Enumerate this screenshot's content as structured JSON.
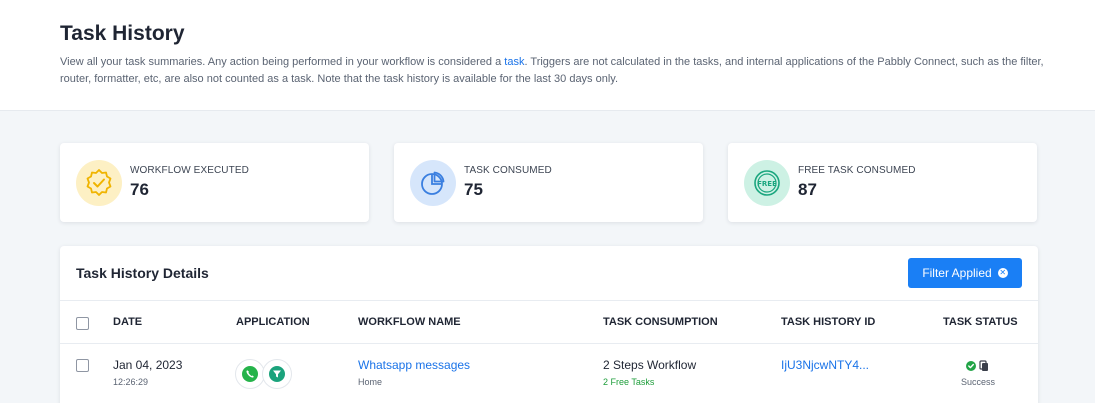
{
  "header": {
    "title": "Task History",
    "desc_part1": "View all your task summaries. Any action being performed in your workflow is considered a ",
    "desc_link": "task",
    "desc_part2": ". Triggers are not calculated in the tasks, and internal applications of the Pabbly Connect, such as the filter, router, formatter, etc, are also not counted as a task. Note that the task history is available for the last 30 days only."
  },
  "stats": [
    {
      "label": "WORKFLOW EXECUTED",
      "value": "76",
      "icon": "verified-badge-icon",
      "color": "#f5b700"
    },
    {
      "label": "TASK CONSUMED",
      "value": "75",
      "icon": "pie-chart-icon",
      "color": "#4a8be8"
    },
    {
      "label": "FREE TASK CONSUMED",
      "value": "87",
      "icon": "free-badge-icon",
      "color": "#1fb38a"
    }
  ],
  "details": {
    "title": "Task History Details",
    "filter_label": "Filter Applied",
    "columns": [
      "DATE",
      "APPLICATION",
      "WORKFLOW NAME",
      "TASK CONSUMPTION",
      "TASK HISTORY ID",
      "TASK STATUS"
    ],
    "rows": [
      {
        "date": "Jan 04, 2023",
        "time": "12:26:29",
        "apps": [
          "whatsapp-icon",
          "filter-icon"
        ],
        "workflow_name": "Whatsapp messages",
        "workflow_folder": "Home",
        "consumption": "2 Steps Workflow",
        "free_tasks": "2 Free Tasks",
        "history_id": "IjU3NjcwNTY4...",
        "status": "Success"
      }
    ]
  }
}
